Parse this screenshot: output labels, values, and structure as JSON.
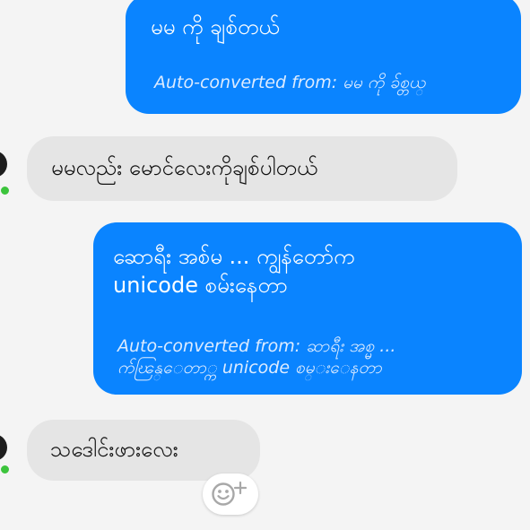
{
  "messages": [
    {
      "direction": "sent",
      "text": "မမ ကို ချစ်တယ်",
      "converted_prefix": "Auto-converted from: ",
      "converted_source": "မမ ကို ခ်စ္တယ္"
    },
    {
      "direction": "received",
      "text": "မမလည်း မောင်လေးကိုချစ်ပါတယ်"
    },
    {
      "direction": "sent",
      "text": "ဆောရီး အစ်မ ... ကျွန်တော်က\nunicode စမ်းနေတာ",
      "converted_prefix": "Auto-converted from: ",
      "converted_source": "ဆာရီး အစ္မ ...\nက်ၽြန္ေတာ္က unicode စမ္းေနတာ"
    },
    {
      "direction": "received",
      "text": "သဒေါင်းဖားလေး"
    }
  ],
  "icons": {
    "avatar": "contact-avatar",
    "online": "online-status-dot",
    "reaction": "add-reaction-smiley-icon"
  },
  "colors": {
    "sent_bubble": "#0a84ff",
    "received_bubble": "#e5e5e5",
    "background": "#f4f4f4",
    "online_dot": "#3cc43c"
  }
}
